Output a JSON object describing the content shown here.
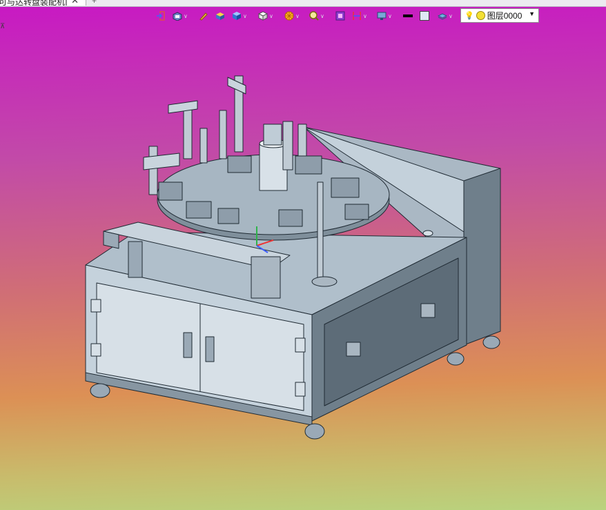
{
  "tab": {
    "title": "可与达转盘装配机]",
    "close": "✕",
    "add": "+"
  },
  "corner_mark": "⊼",
  "toolbar": {
    "icons": [
      "exit-door-icon",
      "view-cube-icon",
      "pencil-icon",
      "box-shade-icon",
      "solid-blue-cube-icon",
      "white-cube-icon",
      "section-icon",
      "zoom-icon",
      "purple-frame-icon",
      "dimension-icon",
      "display-icon",
      "black-line-icon",
      "light-fill-icon",
      "layer-stack-icon"
    ],
    "layer": {
      "value": "图层0000",
      "bulb": "💡"
    }
  }
}
